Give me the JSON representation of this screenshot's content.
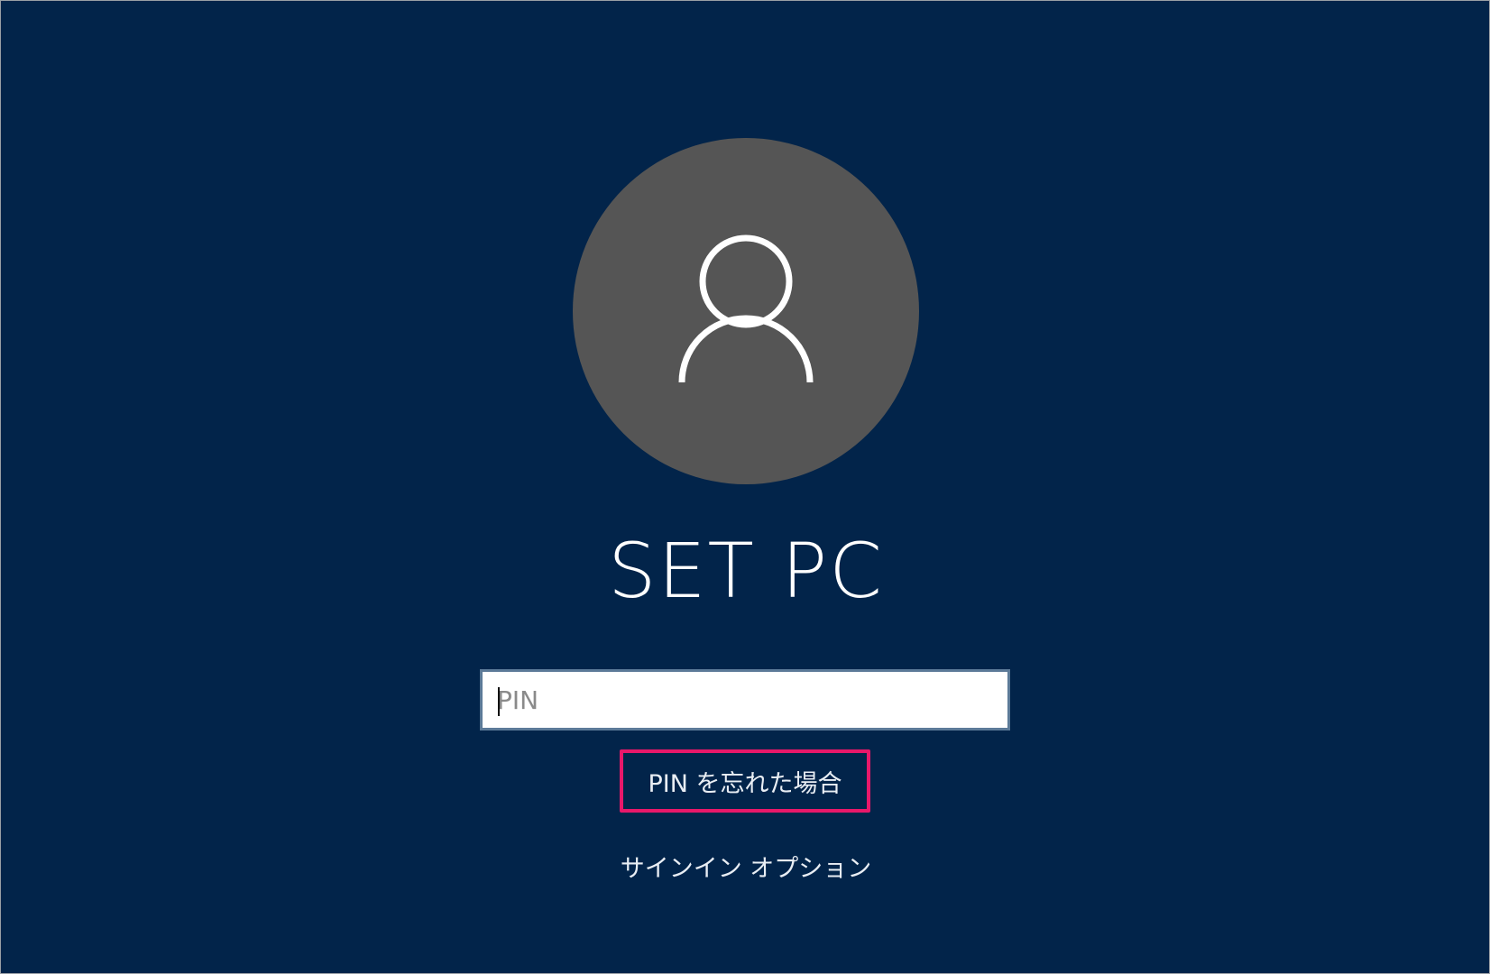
{
  "user": {
    "avatar_icon": "user-silhouette-icon",
    "name": "SET PC"
  },
  "pin": {
    "placeholder": "PIN",
    "value": ""
  },
  "links": {
    "forgot_pin": "PIN を忘れた場合",
    "signin_options": "サインイン オプション"
  },
  "colors": {
    "background": "#02244a",
    "avatar": "#555555",
    "highlight_border": "#e8186a",
    "input_border": "#5c7a98"
  }
}
